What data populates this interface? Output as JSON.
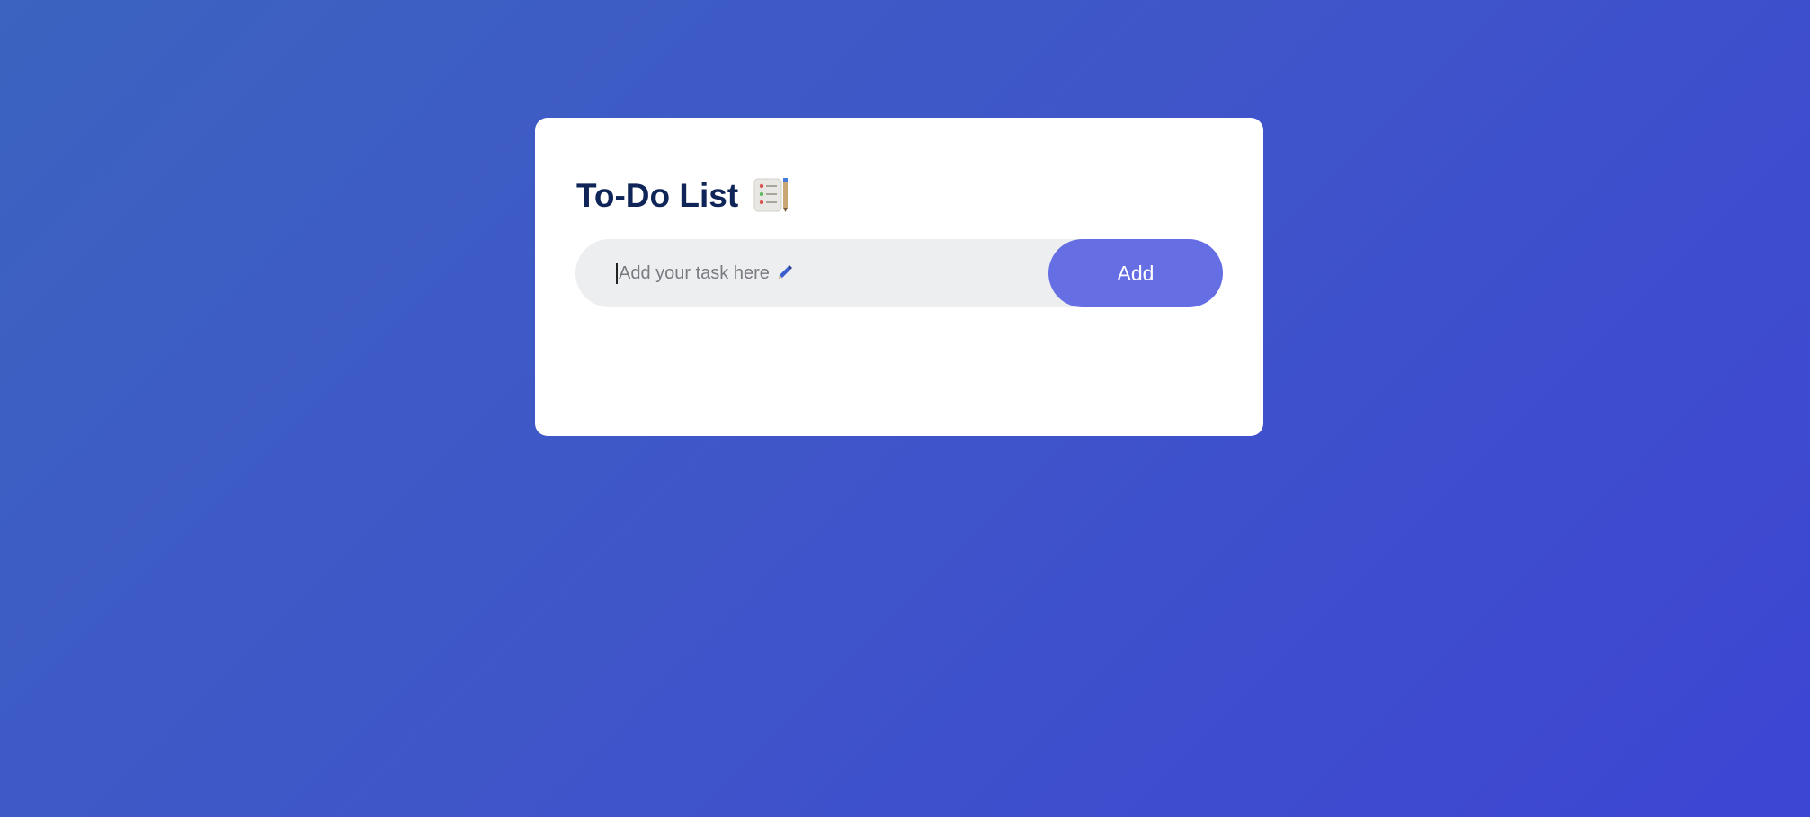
{
  "app": {
    "title": "To-Do List"
  },
  "input": {
    "placeholder": "Add your task here",
    "value": ""
  },
  "add_button": {
    "label": "Add"
  },
  "icons": {
    "title_icon": "checklist-notepad-icon",
    "placeholder_icon": "pencil-icon"
  },
  "colors": {
    "background_start": "#3c63c0",
    "background_end": "#3d45d3",
    "card": "#ffffff",
    "title": "#0f2457",
    "input_bg": "#edeef0",
    "button": "#666ee4",
    "button_text": "#ffffff"
  },
  "tasks": []
}
